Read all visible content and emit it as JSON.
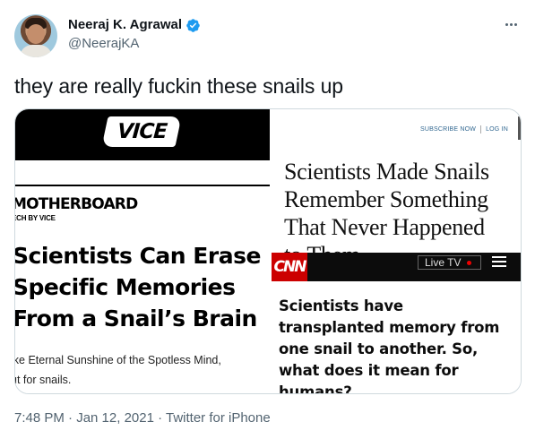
{
  "tweet": {
    "author": {
      "display_name": "Neeraj K. Agrawal",
      "handle": "@NeerajKA",
      "verified_icon": "verified-badge-icon",
      "avatar_icon": "profile-photo"
    },
    "more_icon": "ellipsis-icon",
    "text": "they are really fuckin these snails up",
    "timestamp": "7:48 PM · Jan 12, 2021 · Twitter for iPhone"
  },
  "media": {
    "vice": {
      "logo": "VICE",
      "section": "MOTHERBOARD",
      "subsection": "ECH BY VICE",
      "headline_lines": [
        "Scientists Can Erase",
        "Specific Memories",
        "From a Snail’s Brain"
      ],
      "dek_lines": [
        "ike Eternal Sunshine of the Spotless Mind,",
        "ut for snails."
      ]
    },
    "nyt": {
      "subscribe": "SUBSCRIBE NOW",
      "login": "LOG IN",
      "headline_lines": [
        "Scientists Made Snails",
        "Remember Something",
        "That Never Happened",
        "to Them"
      ]
    },
    "cnn": {
      "logo": "CNN",
      "live_tv": "Live TV",
      "menu_icon": "hamburger-menu-icon",
      "headline_lines": [
        "Scientists have",
        "transplanted memory from",
        "one snail to another. So,",
        "what does it mean for",
        "humans?"
      ]
    }
  },
  "colors": {
    "text_primary": "#0f1419",
    "text_secondary": "#536471",
    "verified_blue": "#1d9bf0",
    "cnn_red": "#cc0000",
    "nyt_link": "#326891"
  }
}
